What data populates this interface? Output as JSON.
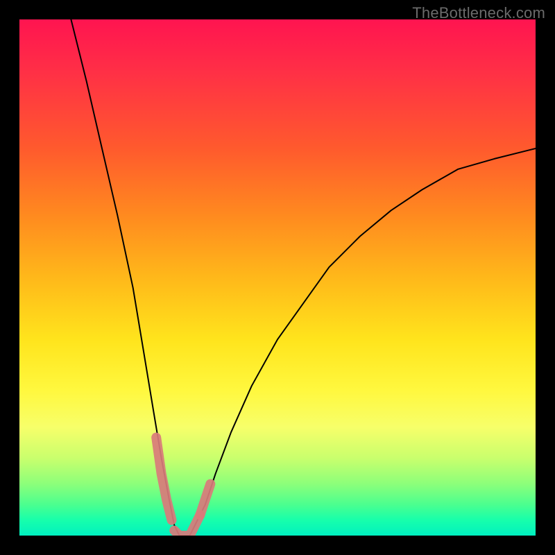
{
  "watermark": "TheBottleneck.com",
  "chart_data": {
    "type": "line",
    "title": "",
    "xlabel": "",
    "ylabel": "",
    "xlim": [
      0,
      100
    ],
    "ylim": [
      0,
      100
    ],
    "background_gradient": {
      "top": "#ff1450",
      "mid": "#ffe41c",
      "bottom": "#00f0c0"
    },
    "series": [
      {
        "name": "bottleneck-curve",
        "x": [
          10,
          13,
          16,
          19,
          22,
          24,
          26,
          27.5,
          29,
          30,
          31,
          32,
          33,
          34,
          36,
          38,
          41,
          45,
          50,
          55,
          60,
          66,
          72,
          78,
          85,
          92,
          100
        ],
        "y": [
          100,
          88,
          75,
          62,
          48,
          36,
          24,
          15,
          7,
          2,
          0,
          0,
          0,
          2,
          6,
          12,
          20,
          29,
          38,
          45,
          52,
          58,
          63,
          67,
          71,
          73,
          75
        ]
      }
    ],
    "markers": [
      {
        "name": "highlight-left",
        "kind": "stroke",
        "x": [
          26.5,
          27.5,
          28.5,
          29.5
        ],
        "y": [
          19,
          12,
          7,
          3
        ]
      },
      {
        "name": "highlight-valley",
        "kind": "stroke",
        "x": [
          30,
          31,
          32,
          33,
          34,
          35
        ],
        "y": [
          1,
          0,
          0,
          0,
          2,
          4
        ]
      },
      {
        "name": "highlight-right",
        "kind": "stroke",
        "x": [
          35,
          36,
          37
        ],
        "y": [
          4,
          7,
          10
        ]
      }
    ]
  }
}
